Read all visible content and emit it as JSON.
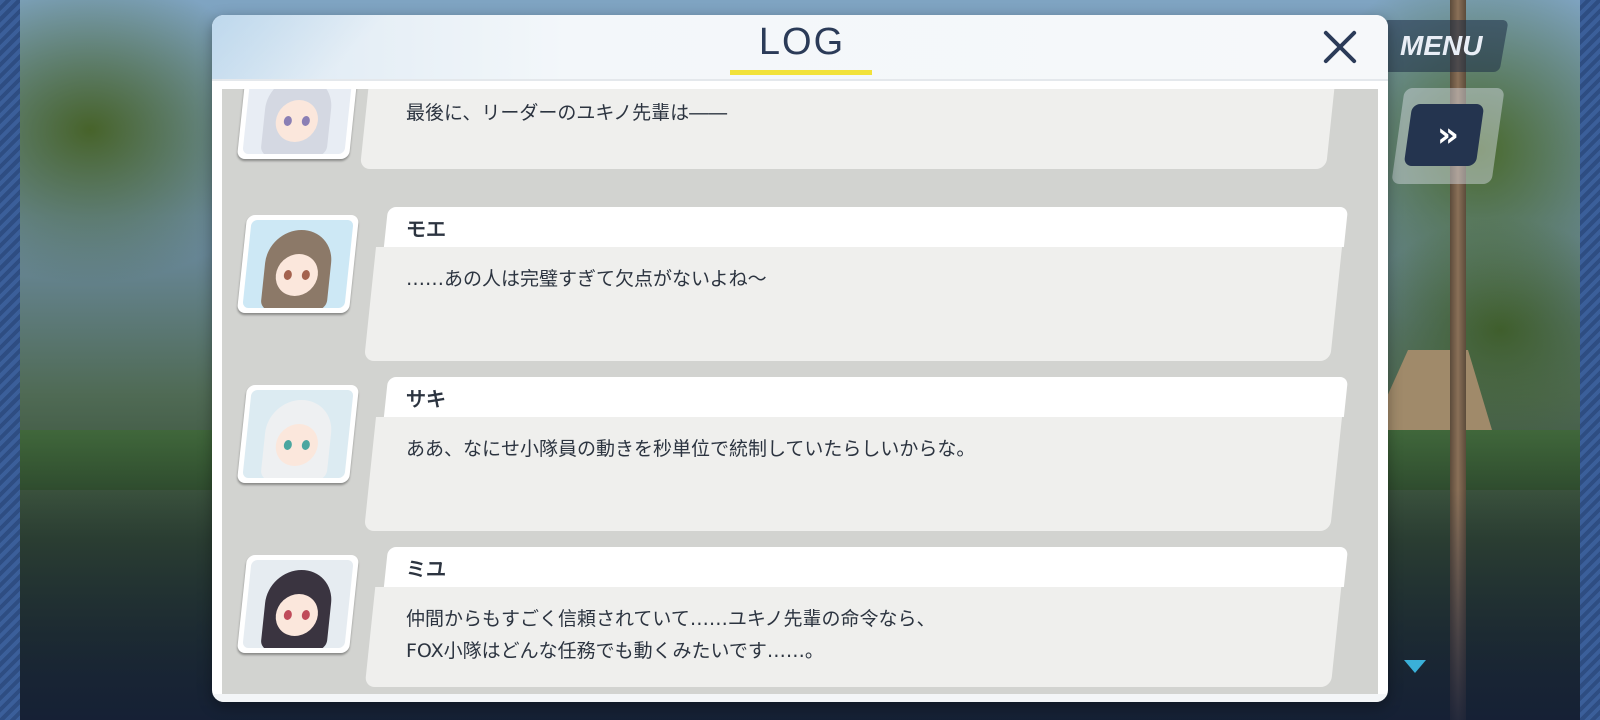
{
  "hud": {
    "menu_label": "MENU",
    "fast_forward_glyph": "»"
  },
  "log": {
    "title": "LOG",
    "close_glyph": "×",
    "entries": [
      {
        "speaker": "",
        "portrait": "silver-hair-character-portrait",
        "text": "最後に、リーダーのユキノ先輩は――"
      },
      {
        "speaker": "モエ",
        "portrait": "moe-portrait",
        "text": "……あの人は完璧すぎて欠点がないよね～"
      },
      {
        "speaker": "サキ",
        "portrait": "saki-portrait",
        "text": "ああ、なにせ小隊員の動きを秒単位で統制していたらしいからな。"
      },
      {
        "speaker": "ミユ",
        "portrait": "miyu-portrait",
        "text": "仲間からもすごく信頼されていて……ユキノ先輩の命令なら、\nFOX小隊はどんな任務でも動くみたいです……。"
      }
    ]
  },
  "colors": {
    "title_underline": "#f2e23a",
    "title_text": "#2b3b58",
    "list_background": "#d2d3d0",
    "bubble": "#efefed",
    "scroll_indicator": "#3ab0d8"
  }
}
